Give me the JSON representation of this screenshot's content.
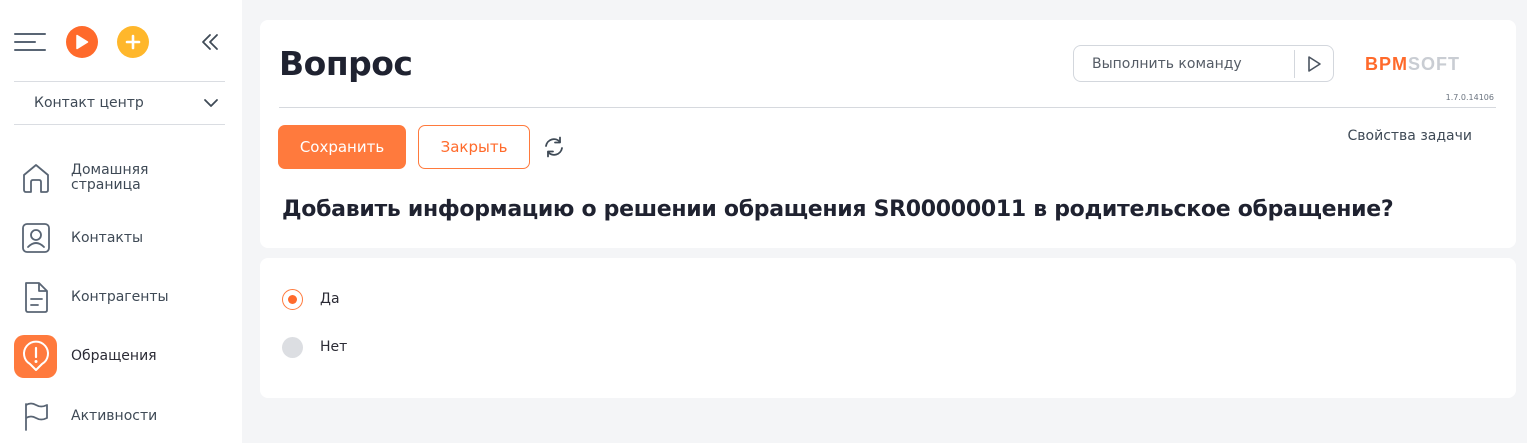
{
  "sidebar": {
    "workplace": "Контакт центр",
    "items": [
      {
        "label": "Домашняя страница"
      },
      {
        "label": "Контакты"
      },
      {
        "label": "Контрагенты"
      },
      {
        "label": "Обращения",
        "active": true
      },
      {
        "label": "Активности"
      }
    ]
  },
  "header": {
    "title": "Вопрос",
    "command_placeholder": "Выполнить команду",
    "logo": "BPMSOFT",
    "version": "1.7.0.14106",
    "save_label": "Сохранить",
    "close_label": "Закрыть",
    "task_properties": "Свойства задачи",
    "question": "Добавить информацию о решении обращения SR00000011 в родительское обращение?"
  },
  "answers": [
    {
      "label": "Да",
      "selected": true
    },
    {
      "label": "Нет",
      "selected": false
    }
  ],
  "colors": {
    "accent": "#ff7a3d",
    "accent_dark": "#ff6a2b",
    "add": "#ffb72b",
    "background": "#f4f5f7"
  }
}
